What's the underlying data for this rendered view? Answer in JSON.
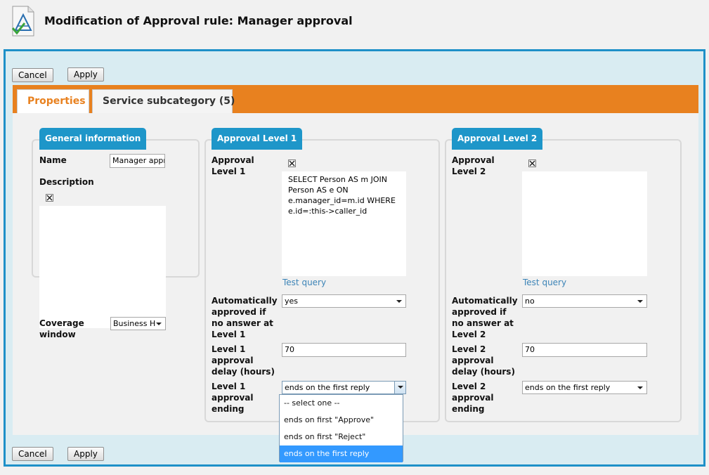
{
  "header": {
    "title": "Modification of Approval rule: Manager approval",
    "icon": "approval-rule-icon"
  },
  "toolbar": {
    "cancel_label": "Cancel",
    "apply_label": "Apply"
  },
  "tabs": [
    {
      "label": "Properties",
      "active": true
    },
    {
      "label": "Service subcategory (5)",
      "active": false
    }
  ],
  "general": {
    "legend": "General information",
    "name_label": "Name",
    "name_value": "Manager appr",
    "description_label": "Description",
    "coverage_label": "Coverage window",
    "coverage_value": "Business H"
  },
  "level1": {
    "legend": "Approval Level 1",
    "query_label": "Approval Level 1",
    "query_lines": [
      "SELECT Person AS m JOIN",
      "Person AS e ON",
      "e.manager_id=m.id WHERE",
      "e.id=:this->caller_id"
    ],
    "test_query": "Test query",
    "auto_label": "Automatically approved if no answer at Level 1",
    "auto_value": "yes",
    "delay_label": "Level 1 approval delay (hours)",
    "delay_value": "70",
    "ending_label": "Level 1 approval ending",
    "ending_value": "ends on the first reply",
    "ending_options": [
      "-- select one --",
      "ends on first \"Approve\"",
      "ends on first \"Reject\"",
      "ends on the first reply"
    ]
  },
  "level2": {
    "legend": "Approval Level 2",
    "query_label": "Approval Level 2",
    "test_query": "Test query",
    "auto_label": "Automatically approved if no answer at Level 2",
    "auto_value": "no",
    "delay_label": "Level 2 approval delay (hours)",
    "delay_value": "70",
    "ending_label": "Level 2 approval ending",
    "ending_value": "ends on the first reply"
  },
  "colors": {
    "accent_blue": "#1e96c9",
    "tab_orange": "#e8811f",
    "selection_blue": "#3399ff",
    "link_blue": "#3c84b7"
  }
}
